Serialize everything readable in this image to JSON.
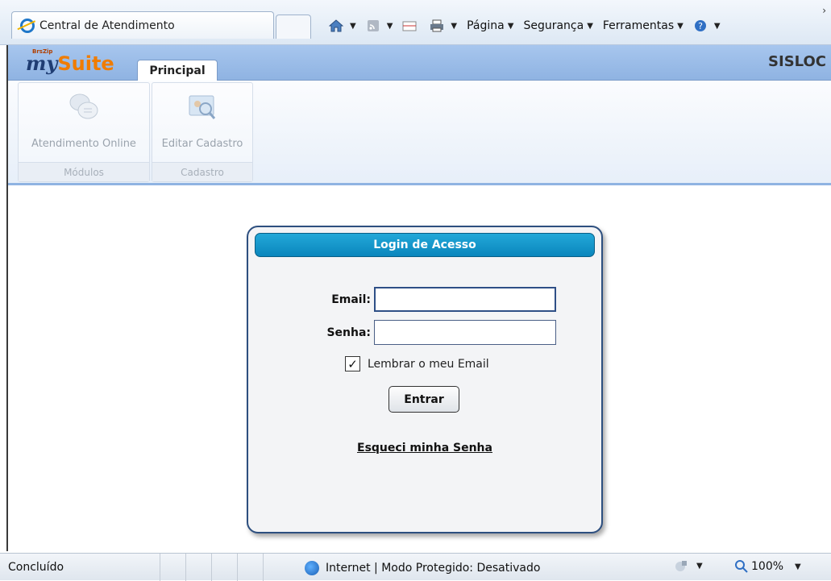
{
  "browser": {
    "tab_title": "Central de Atendimento",
    "menu": {
      "page": "Página",
      "security": "Segurança",
      "tools": "Ferramentas"
    },
    "icons": [
      "home-icon",
      "feeds-icon",
      "mail-icon",
      "print-icon",
      "help-icon"
    ]
  },
  "app": {
    "logo_small": "BrsZip",
    "logo_my": "my",
    "logo_suite": "Suite",
    "main_tab": "Principal",
    "company": "SISLOC"
  },
  "ribbon": {
    "groups": [
      {
        "button": "Atendimento Online",
        "label": "Módulos"
      },
      {
        "button": "Editar Cadastro",
        "label": "Cadastro"
      }
    ]
  },
  "login": {
    "title": "Login de Acesso",
    "email_label": "Email:",
    "email_value": "",
    "password_label": "Senha:",
    "password_value": "",
    "remember_label": "Lembrar o meu Email",
    "remember_checked": true,
    "submit_label": "Entrar",
    "forgot_link": "Esqueci minha Senha"
  },
  "status": {
    "left": "Concluído",
    "zone": "Internet | Modo Protegido: Desativado",
    "zoom": "100%"
  },
  "colors": {
    "accent": "#0a86bd",
    "ribbon_bar": "#8fb3e2",
    "login_border": "#2d4f7f"
  }
}
